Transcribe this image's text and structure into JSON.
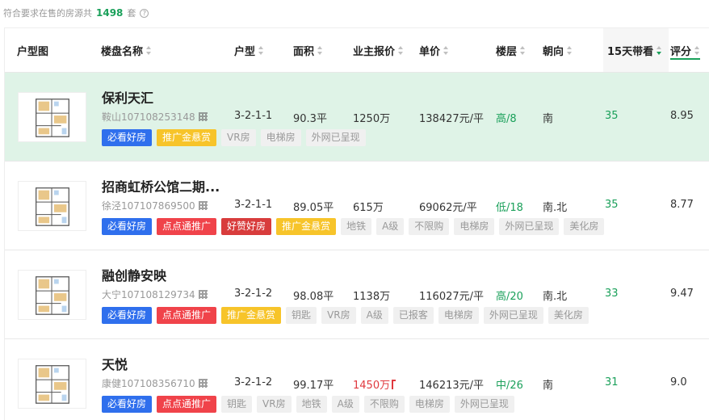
{
  "summary": {
    "prefix": "符合要求在售的房源共",
    "count": "1498",
    "suffix": "套",
    "help_icon": "question-circle-icon"
  },
  "columns": [
    {
      "label": "户型图",
      "sortable": false
    },
    {
      "label": "楼盘名称",
      "sortable": true
    },
    {
      "label": "户型",
      "sortable": true
    },
    {
      "label": "面积",
      "sortable": true
    },
    {
      "label": "业主报价",
      "sortable": true
    },
    {
      "label": "单价",
      "sortable": true
    },
    {
      "label": "楼层",
      "sortable": true
    },
    {
      "label": "朝向",
      "sortable": true
    },
    {
      "label": "15天带看",
      "sortable": true,
      "active": true
    },
    {
      "label": "评分",
      "sortable": true
    }
  ],
  "colors": {
    "accent_green": "#1aa05a",
    "highlight_row": "#dff3e7",
    "tag_blue": "#2f6fed",
    "tag_yellow": "#f7c42a",
    "tag_red": "#f0434a",
    "price_red": "#e0393e"
  },
  "rows": [
    {
      "name": "保利天汇",
      "code": "鞍山107108253148",
      "layout": "3-2-1-1",
      "area": "90.3平",
      "price": "1250万",
      "unit_price": "138427元/平",
      "floor": "高/8",
      "orientation": "南",
      "visits": "35",
      "score": "8.95",
      "tags": [
        {
          "label": "必看好房",
          "style": "blue"
        },
        {
          "label": "推广金悬赏",
          "style": "yellow"
        },
        {
          "label": "VR房",
          "style": "gray"
        },
        {
          "label": "电梯房",
          "style": "gray"
        },
        {
          "label": "外网已呈现",
          "style": "gray"
        }
      ]
    },
    {
      "name": "招商虹桥公馆二期...",
      "code": "徐泾107107869500",
      "layout": "3-2-1-1",
      "area": "89.05平",
      "price": "615万",
      "unit_price": "69062元/平",
      "floor": "低/18",
      "orientation": "南.北",
      "visits": "35",
      "score": "8.77",
      "tags": [
        {
          "label": "必看好房",
          "style": "blue"
        },
        {
          "label": "点点通推广",
          "style": "red"
        },
        {
          "label": "好赞好房",
          "style": "darkred"
        },
        {
          "label": "推广金悬赏",
          "style": "yellow"
        },
        {
          "label": "地铁",
          "style": "gray"
        },
        {
          "label": "A级",
          "style": "gray"
        },
        {
          "label": "不限购",
          "style": "gray"
        },
        {
          "label": "电梯房",
          "style": "gray"
        },
        {
          "label": "外网已呈现",
          "style": "gray"
        },
        {
          "label": "美化房",
          "style": "gray"
        }
      ]
    },
    {
      "name": "融创静安映",
      "code": "大宁107108129734",
      "layout": "3-2-1-2",
      "area": "98.08平",
      "price": "1138万",
      "unit_price": "116027元/平",
      "floor": "高/20",
      "orientation": "南.北",
      "visits": "33",
      "score": "9.47",
      "tags": [
        {
          "label": "必看好房",
          "style": "blue"
        },
        {
          "label": "点点通推广",
          "style": "red"
        },
        {
          "label": "推广金悬赏",
          "style": "yellow"
        },
        {
          "label": "钥匙",
          "style": "gray"
        },
        {
          "label": "VR房",
          "style": "gray"
        },
        {
          "label": "A级",
          "style": "gray"
        },
        {
          "label": "已报客",
          "style": "gray"
        },
        {
          "label": "电梯房",
          "style": "gray"
        },
        {
          "label": "外网已呈现",
          "style": "gray"
        },
        {
          "label": "美化房",
          "style": "gray"
        }
      ]
    },
    {
      "name": "天悦",
      "code": "康健107108356710",
      "layout": "3-2-1-2",
      "area": "99.17平",
      "price": "1450万",
      "price_rising": true,
      "unit_price": "146213元/平",
      "floor": "中/26",
      "orientation": "南",
      "visits": "31",
      "score": "9.0",
      "tags": [
        {
          "label": "必看好房",
          "style": "blue"
        },
        {
          "label": "点点通推广",
          "style": "red"
        },
        {
          "label": "钥匙",
          "style": "gray"
        },
        {
          "label": "VR房",
          "style": "gray"
        },
        {
          "label": "地铁",
          "style": "gray"
        },
        {
          "label": "A级",
          "style": "gray"
        },
        {
          "label": "不限购",
          "style": "gray"
        },
        {
          "label": "电梯房",
          "style": "gray"
        },
        {
          "label": "外网已呈现",
          "style": "gray"
        }
      ]
    }
  ]
}
